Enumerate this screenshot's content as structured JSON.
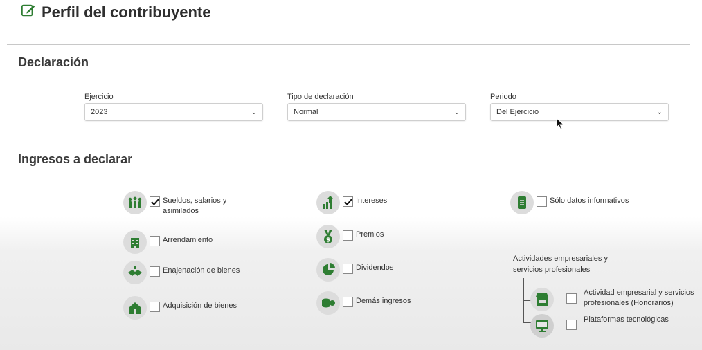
{
  "header": {
    "title": "Perfil del contribuyente",
    "icon": "edit-icon"
  },
  "declaracion": {
    "title": "Declaración",
    "ejercicio": {
      "label": "Ejercicio",
      "value": "2023"
    },
    "tipo": {
      "label": "Tipo de declaración",
      "value": "Normal"
    },
    "periodo": {
      "label": "Periodo",
      "value": "Del Ejercicio"
    }
  },
  "ingresos": {
    "title": "Ingresos a declarar",
    "col1": [
      {
        "label": "Sueldos, salarios y asimilados",
        "checked": true,
        "icon": "people-icon"
      },
      {
        "label": "Arrendamiento",
        "checked": false,
        "icon": "building-icon"
      },
      {
        "label": "Enajenación de bienes",
        "checked": false,
        "icon": "handshake-icon"
      },
      {
        "label": "Adquisición de bienes",
        "checked": false,
        "icon": "house-icon"
      }
    ],
    "col2": [
      {
        "label": "Intereses",
        "checked": true,
        "icon": "growth-icon"
      },
      {
        "label": "Premios",
        "checked": false,
        "icon": "medal-icon"
      },
      {
        "label": "Dividendos",
        "checked": false,
        "icon": "pie-chart-icon"
      },
      {
        "label": "Demás ingresos",
        "checked": false,
        "icon": "coins-icon"
      }
    ],
    "col3": {
      "informativos": {
        "label": "Sólo datos informativos",
        "checked": false,
        "icon": "document-icon"
      },
      "actividades_title": "Actividades empresariales y servicios profesionales",
      "honorarios": {
        "label": "Actividad empresarial y servicios profesionales (Honorarios)",
        "checked": false,
        "icon": "store-icon"
      },
      "plataformas": {
        "label": "Plataformas tecnológicas",
        "checked": false,
        "icon": "monitor-icon"
      }
    }
  },
  "colors": {
    "accent": "#2e7d32",
    "icon_bg": "#dcdcdc"
  }
}
